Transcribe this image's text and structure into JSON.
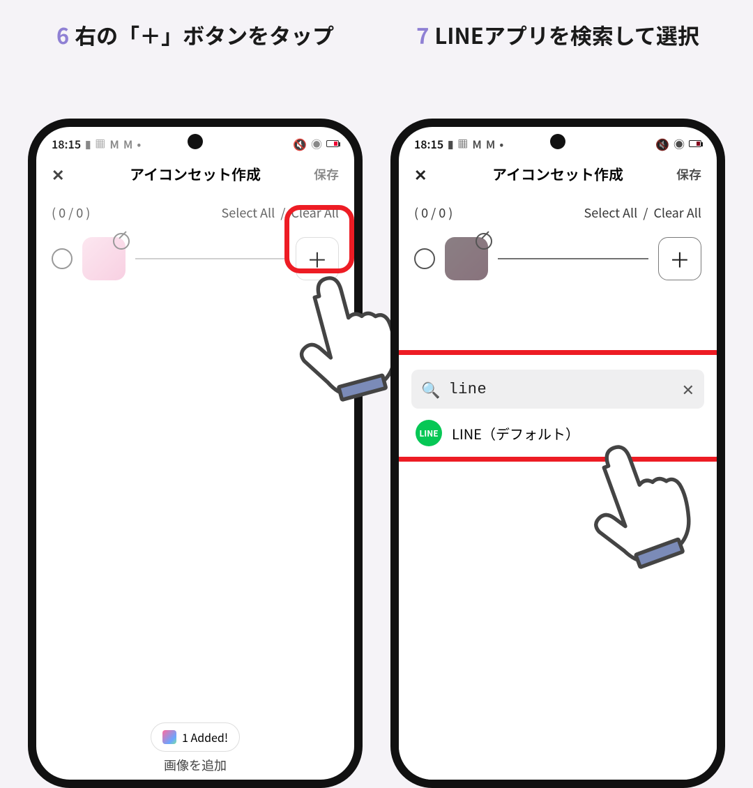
{
  "steps": [
    {
      "num": "6",
      "text": "右の「＋」ボタンをタップ"
    },
    {
      "num": "7",
      "text": "LINEアプリを検索して選択"
    }
  ],
  "statusbar": {
    "time": "18:15",
    "icons_left": [
      "battery-saver",
      "grid",
      "M",
      "M",
      "•"
    ],
    "icons_right": [
      "mute",
      "wifi",
      "battery-low"
    ]
  },
  "appbar": {
    "close": "✕",
    "title": "アイコンセット作成",
    "save": "保存"
  },
  "subbar": {
    "counter": "( 0 / 0 )",
    "select_all": "Select All",
    "divider": "/",
    "clear_all": "Clear All"
  },
  "item": {
    "plus": "＋"
  },
  "toast": {
    "label": "1 Added!"
  },
  "bottom_label": "画像を追加",
  "search": {
    "query": "line",
    "clear": "✕"
  },
  "result": {
    "line_badge": "LINE",
    "label": "LINE（デフォルト）"
  }
}
